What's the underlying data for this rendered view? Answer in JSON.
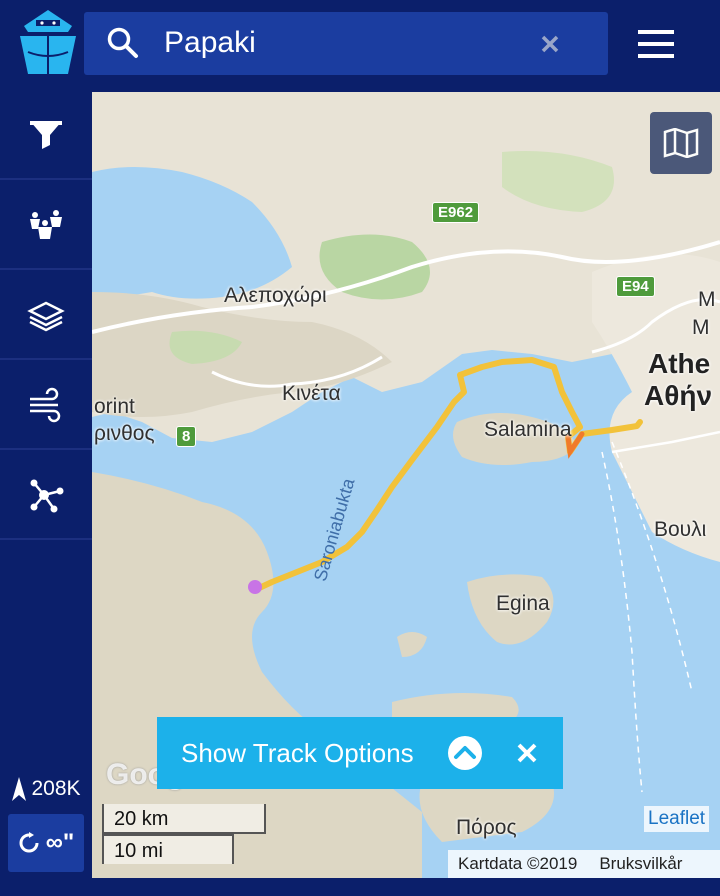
{
  "search": {
    "query": "Papaki"
  },
  "sidebar": {
    "items": [
      {
        "name": "filter",
        "icon": "filter-icon"
      },
      {
        "name": "fleets",
        "icon": "ship-group-icon"
      },
      {
        "name": "layers",
        "icon": "layers-icon"
      },
      {
        "name": "wind",
        "icon": "wind-icon"
      },
      {
        "name": "network",
        "icon": "network-icon"
      }
    ],
    "stats_count": "208K",
    "speed_label": "∞\""
  },
  "map": {
    "labels": [
      {
        "id": "alepochori",
        "text": "Αλεποχώρι"
      },
      {
        "id": "kineta",
        "text": "Κινέτα"
      },
      {
        "id": "korinth-1",
        "text": "orint"
      },
      {
        "id": "korinth-2",
        "text": "ρινθος"
      },
      {
        "id": "salamina",
        "text": "Salamina"
      },
      {
        "id": "athens-1",
        "text": "Athe"
      },
      {
        "id": "athens-2",
        "text": "Αθήν"
      },
      {
        "id": "m1",
        "text": "M"
      },
      {
        "id": "m2",
        "text": "Μ"
      },
      {
        "id": "vouli",
        "text": "Βουλι"
      },
      {
        "id": "egina",
        "text": "Egina"
      },
      {
        "id": "saronia",
        "text": "Saroniabukta"
      },
      {
        "id": "poros",
        "text": "Πόρος"
      }
    ],
    "road_shields": [
      {
        "id": "e962",
        "text": "E962"
      },
      {
        "id": "e94",
        "text": "E94"
      },
      {
        "id": "r8",
        "text": "8"
      }
    ],
    "track_button": "Show Track Options",
    "scale_km": "20 km",
    "scale_mi": "10 mi",
    "attribution_leaflet": "Leaflet",
    "attribution_data": "Kartdata ©2019",
    "attribution_terms": "Bruksvilkår",
    "google_watermark": "Google"
  },
  "colors": {
    "header": "#0b1f6b",
    "search_bg": "#1b3da0",
    "track_panel": "#1cb1ea",
    "water": "#a6d2f3",
    "track": "#f2c23a"
  }
}
